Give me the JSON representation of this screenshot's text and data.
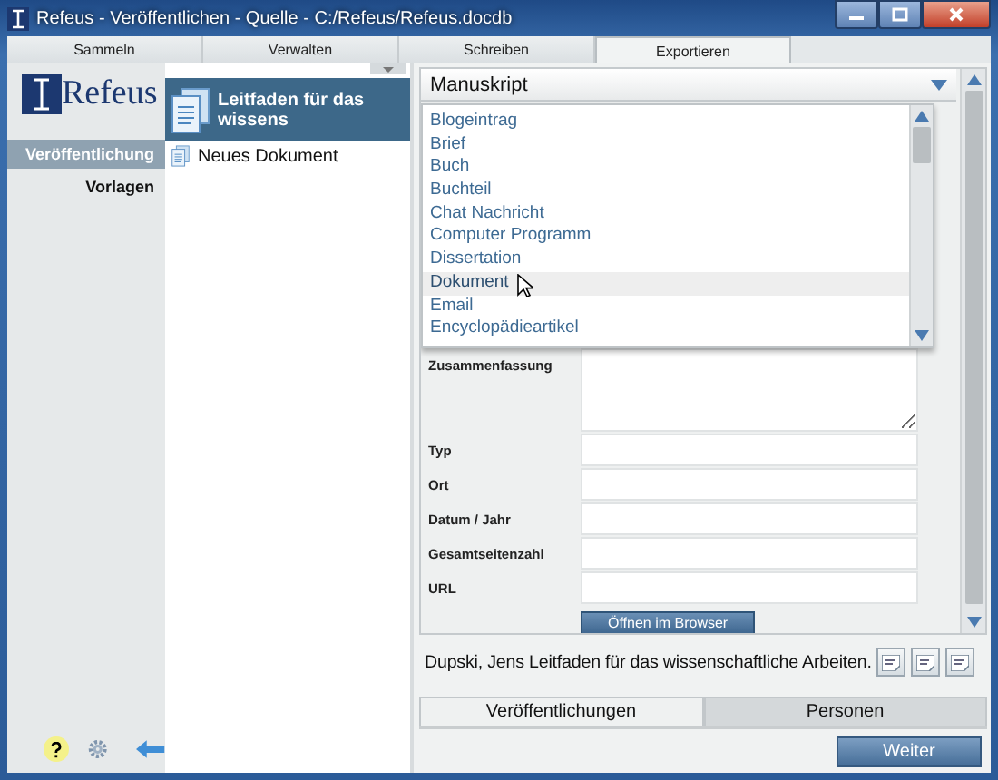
{
  "window": {
    "title": "Refeus - Veröffentlichen - Quelle - C:/Refeus/Refeus.docdb"
  },
  "tabs": [
    {
      "label": "Sammeln",
      "selected": false
    },
    {
      "label": "Verwalten",
      "selected": false
    },
    {
      "label": "Schreiben",
      "selected": false
    },
    {
      "label": "Exportieren",
      "selected": true
    }
  ],
  "sidebar": {
    "logo": "Refeus",
    "items": [
      {
        "label": "Veröffentlichung",
        "selected": true
      },
      {
        "label": "Vorlagen",
        "selected": false
      }
    ]
  },
  "documents": [
    {
      "label": "Leitfaden für das wissens",
      "selected": true
    },
    {
      "label": "Neues Dokument",
      "selected": false
    }
  ],
  "type_select": {
    "value": "Manuskript",
    "options": [
      {
        "label": "Blogeintrag",
        "highlighted": false
      },
      {
        "label": "Brief",
        "highlighted": false
      },
      {
        "label": "Buch",
        "highlighted": false
      },
      {
        "label": "Buchteil",
        "highlighted": false
      },
      {
        "label": "Chat Nachricht",
        "highlighted": false
      },
      {
        "label": "Computer Programm",
        "highlighted": false
      },
      {
        "label": "Dissertation",
        "highlighted": false
      },
      {
        "label": "Dokument",
        "highlighted": true
      },
      {
        "label": "Email",
        "highlighted": false
      },
      {
        "label": "Encyclopädieartikel",
        "highlighted": false
      }
    ]
  },
  "form": {
    "fields": [
      {
        "label": "Zusammenfassung",
        "kind": "textarea"
      },
      {
        "label": "Typ",
        "kind": "text"
      },
      {
        "label": "Ort",
        "kind": "text"
      },
      {
        "label": "Datum / Jahr",
        "kind": "text"
      },
      {
        "label": "Gesamtseitenzahl",
        "kind": "text"
      },
      {
        "label": "URL",
        "kind": "text"
      }
    ],
    "button": "Öffnen im Browser"
  },
  "citation": "Dupski, Jens Leitfaden für das wissenschaftliche Arbeiten.",
  "bottom_tabs": [
    {
      "label": "Veröffentlichungen",
      "selected": true
    },
    {
      "label": "Personen",
      "selected": false
    }
  ],
  "next_button": "Weiter"
}
